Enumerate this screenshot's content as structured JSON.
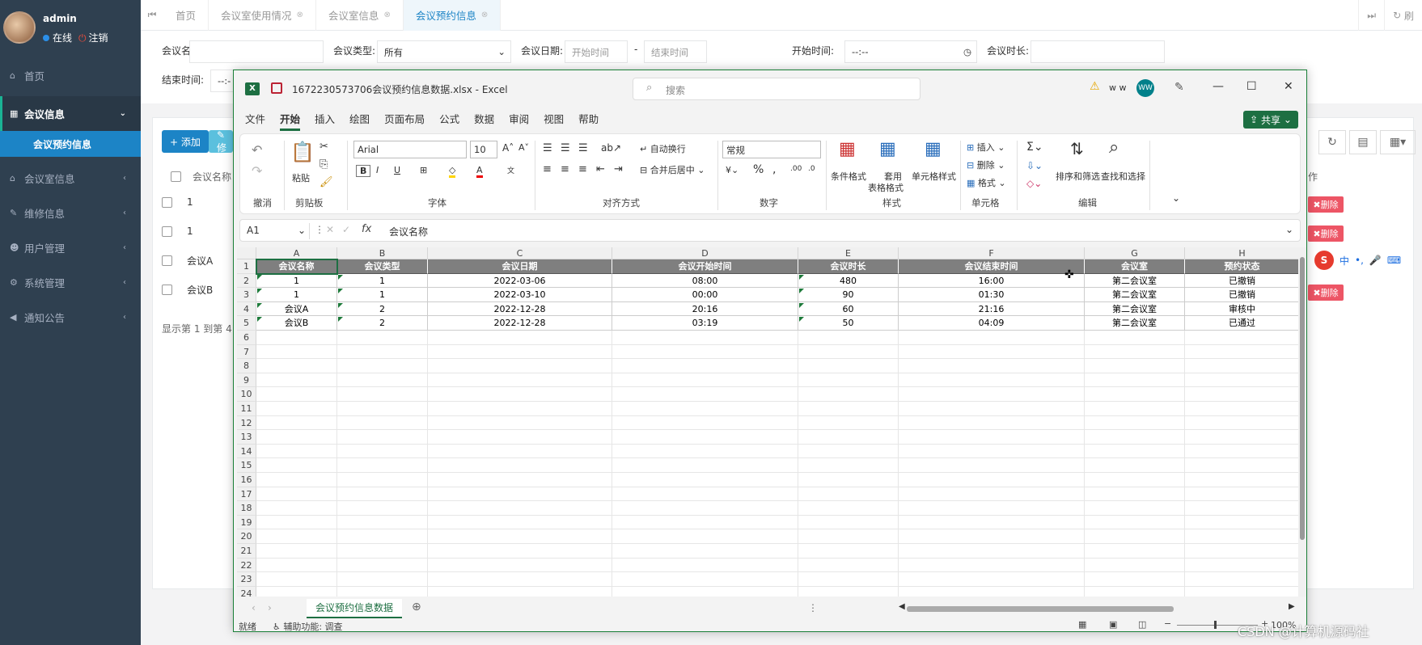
{
  "user": {
    "name": "admin",
    "online": "在线",
    "logout": "注销"
  },
  "sidebar": {
    "items": [
      {
        "label": "首页",
        "icon": "home-icon"
      },
      {
        "label": "会议信息",
        "icon": "calendar-icon"
      },
      {
        "label": "会议室信息",
        "icon": "bank-icon"
      },
      {
        "label": "维修信息",
        "icon": "wrench-icon"
      },
      {
        "label": "用户管理",
        "icon": "users-icon"
      },
      {
        "label": "系统管理",
        "icon": "gear-icon"
      },
      {
        "label": "通知公告",
        "icon": "volume-icon"
      }
    ],
    "sub": "会议预约信息"
  },
  "tabs": [
    "首页",
    "会议室使用情况",
    "会议室信息",
    "会议预约信息"
  ],
  "refresh": "刷",
  "form": {
    "name_label": "会议名称:",
    "type_label": "会议类型:",
    "type_value": "所有",
    "date_label": "会议日期:",
    "date_start": "开始时间",
    "date_sep": "-",
    "date_end": "结束时间",
    "start_label": "开始时间:",
    "start_value": "--:--",
    "dur_label": "会议时长:",
    "end_label": "结束时间:",
    "end_value": "--:-"
  },
  "toolbar": {
    "add": "+ 添加",
    "edit": "✎ 修"
  },
  "table": {
    "col_name": "会议名称",
    "col_op": "作",
    "rows": [
      "1",
      "1",
      "会议A",
      "会议B"
    ],
    "delete": "✖删除",
    "footer": "显示第 1 到第 4"
  },
  "excel": {
    "filename": "1672230573706会议预约信息数据.xlsx  -  Excel",
    "search": "搜索",
    "user": "w w",
    "avatar": "WW",
    "menu": [
      "文件",
      "开始",
      "插入",
      "绘图",
      "页面布局",
      "公式",
      "数据",
      "审阅",
      "视图",
      "帮助"
    ],
    "share": "共享",
    "ribbon": {
      "undo": "撤消",
      "clipboard": "剪贴板",
      "paste": "粘贴",
      "font_group": "字体",
      "font": "Arial",
      "size": "10",
      "align": "对齐方式",
      "wrap": "自动换行",
      "merge": "合并后居中",
      "number": "数字",
      "numfmt": "常规",
      "styles": "样式",
      "cond": "条件格式",
      "tablefmt_1": "套用",
      "tablefmt_2": "表格格式",
      "cellstyle": "单元格样式",
      "cells": "单元格",
      "insert": "插入",
      "delete": "删除",
      "format": "格式",
      "edit": "编辑",
      "sort": "排序和筛选",
      "find": "查找和选择"
    },
    "namebox": "A1",
    "fx": "fx",
    "formula": "会议名称",
    "cols": [
      "A",
      "B",
      "C",
      "D",
      "E",
      "F",
      "G",
      "H"
    ],
    "header": [
      "会议名称",
      "会议类型",
      "会议日期",
      "会议开始时间",
      "会议时长",
      "会议结束时间",
      "会议室",
      "预约状态"
    ],
    "rows": [
      [
        "1",
        "1",
        "2022-03-06",
        "08:00",
        "480",
        "16:00",
        "第二会议室",
        "已撤销"
      ],
      [
        "1",
        "1",
        "2022-03-10",
        "00:00",
        "90",
        "01:30",
        "第二会议室",
        "已撤销"
      ],
      [
        "会议A",
        "2",
        "2022-12-28",
        "20:16",
        "60",
        "21:16",
        "第二会议室",
        "审核中"
      ],
      [
        "会议B",
        "2",
        "2022-12-28",
        "03:19",
        "50",
        "04:09",
        "第二会议室",
        "已通过"
      ]
    ],
    "row_numbers": [
      "1",
      "2",
      "3",
      "4",
      "5",
      "6",
      "7",
      "8",
      "9",
      "10",
      "11",
      "12",
      "13",
      "14",
      "15",
      "16",
      "17",
      "18",
      "19",
      "20",
      "21",
      "22",
      "23",
      "24"
    ],
    "sheet_tab": "会议预约信息数据",
    "status_ready": "就绪",
    "status_access": "辅助功能: 调查",
    "zoom": "100%"
  },
  "ime": {
    "s": "S",
    "zh": "中"
  },
  "watermark": "CSDN @计算机源码社"
}
